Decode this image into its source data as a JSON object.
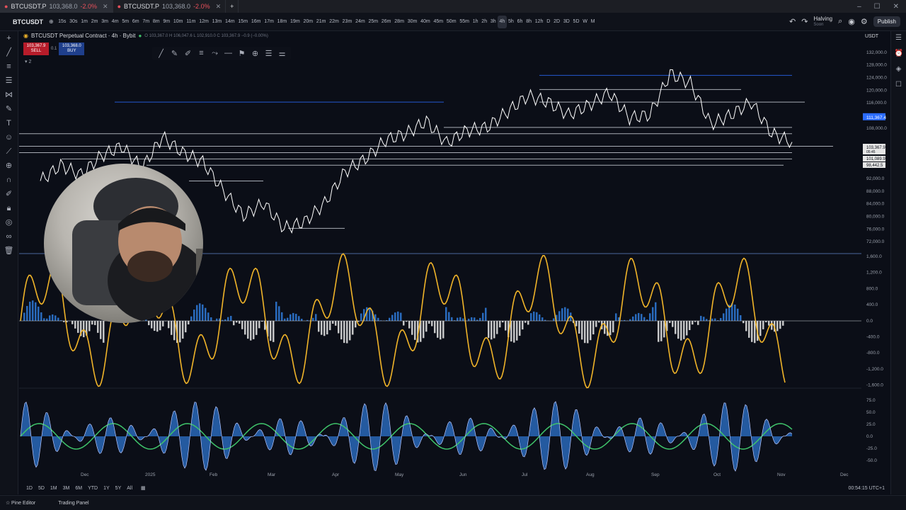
{
  "browser": {
    "tabs": [
      {
        "symbol": "BTCUSDT.P",
        "price": "103,368.0",
        "change": "-2.0%",
        "active": true
      },
      {
        "symbol": "BTCUSDT.P",
        "price": "103,368.0",
        "change": "-2.0%",
        "active": false
      }
    ]
  },
  "toolbar": {
    "symbol": "BTCUSDT",
    "intervals": [
      "15s",
      "30s",
      "1m",
      "2m",
      "3m",
      "4m",
      "5m",
      "6m",
      "7m",
      "8m",
      "9m",
      "10m",
      "11m",
      "12m",
      "13m",
      "14m",
      "15m",
      "16m",
      "17m",
      "18m",
      "19m",
      "20m",
      "21m",
      "22m",
      "23m",
      "24m",
      "25m",
      "26m",
      "28m",
      "30m",
      "40m",
      "45m",
      "50m",
      "55m",
      "1h",
      "2h",
      "3h",
      "4h",
      "5h",
      "6h",
      "8h",
      "12h",
      "D",
      "2D",
      "3D",
      "5D",
      "W",
      "M"
    ],
    "active_interval": "4h",
    "halving_label": "Halving",
    "halving_sub": "Soon",
    "publish_label": "Publish"
  },
  "legend": {
    "title": "BTCUSDT Perpetual Contract · 4h · Bybit",
    "ohlc": "O 103,367.0  H 106,047.6  L 102,910.0  C 103,367.9  −0.9 (−0.00%)",
    "sell_price": "103,367.9",
    "sell_label": "SELL",
    "buy_price": "103,368.0",
    "buy_label": "BUY",
    "spread": "0.1",
    "layer_count": "2"
  },
  "price_axis": {
    "currency": "USDT",
    "labels": [
      "132,000.0",
      "128,000.0",
      "124,000.0",
      "120,000.0",
      "116,000.0",
      "108,000.0",
      "96,000.0",
      "92,000.0",
      "88,000.0",
      "84,000.0",
      "80,000.0",
      "76,000.0",
      "72,000.0"
    ],
    "current_price": "111,367.4",
    "last_price": "103,367.9",
    "countdown": "05:45",
    "tag1": "101,089.9",
    "tag2": "98,442.5"
  },
  "osc1_axis": {
    "labels": [
      "1,600.0",
      "1,200.0",
      "800.0",
      "400.0",
      "0.0",
      "-400.0",
      "-800.0",
      "-1,200.0",
      "-1,600.0"
    ]
  },
  "osc2_axis": {
    "labels": [
      "75.0",
      "50.0",
      "25.0",
      "0.0",
      "-25.0",
      "-50.0"
    ]
  },
  "time_axis": {
    "labels": [
      "Dec",
      "2025",
      "Feb",
      "Mar",
      "Apr",
      "May",
      "Jun",
      "Jul",
      "Aug",
      "Sep",
      "Oct",
      "Nov",
      "Dec"
    ]
  },
  "bottom": {
    "ranges": [
      "1D",
      "5D",
      "1M",
      "3M",
      "6M",
      "YTD",
      "1Y",
      "5Y",
      "All"
    ],
    "utc": "00:54:15 UTC+1"
  },
  "footer": {
    "tabs": [
      "Pine Editor",
      "Trading Panel"
    ]
  },
  "colors": {
    "price_line": "#ffffff",
    "level_blue": "#2b6cff",
    "osc_gold": "#f0b429",
    "osc_blue": "#2f7bdc",
    "wave_green": "#3fc46a"
  },
  "chart_data": {
    "type": "line",
    "series": [
      {
        "values": [
          91000,
          96000,
          93000,
          99000,
          102000,
          95000,
          105000,
          100000,
          97000,
          88000,
          80000,
          84000,
          76000,
          78000,
          84000,
          94000,
          98000,
          104000,
          106000,
          110000,
          103000,
          107000,
          108000,
          113000,
          118000,
          116000,
          112000,
          115000,
          119000,
          111000,
          112000,
          125000,
          122000,
          109000,
          112000,
          116000,
          106000,
          103367
        ]
      }
    ]
  }
}
